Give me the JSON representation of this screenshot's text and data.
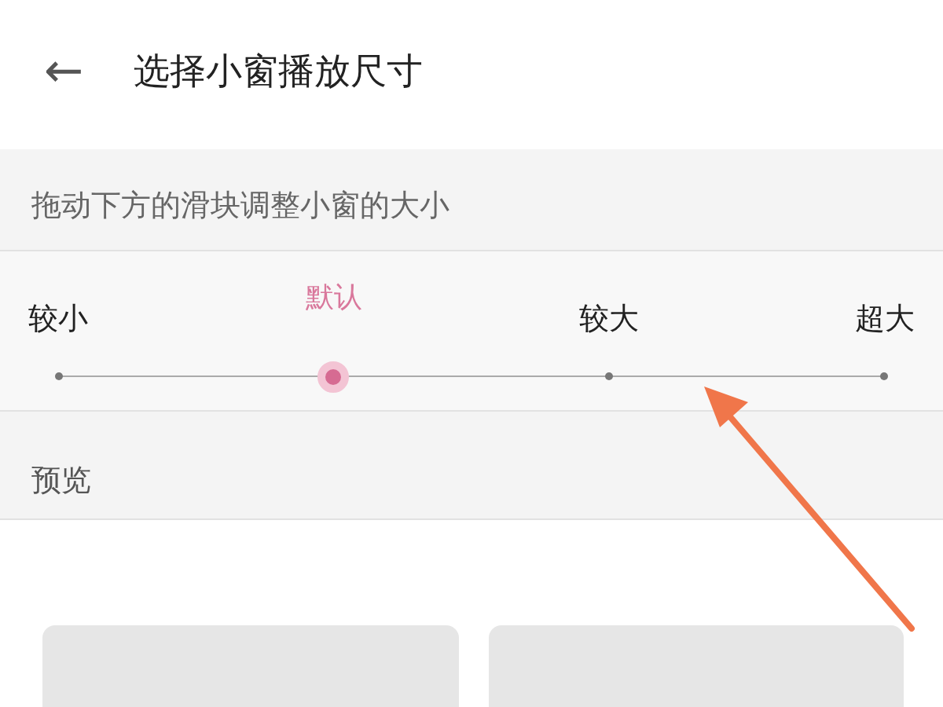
{
  "header": {
    "back": "←",
    "title": "选择小窗播放尺寸"
  },
  "hint": "拖动下方的滑块调整小窗的大小",
  "sizes": [
    {
      "label": "较小",
      "selected": false
    },
    {
      "label": "默认",
      "selected": true
    },
    {
      "label": "较大",
      "selected": false
    },
    {
      "label": "超大",
      "selected": false
    }
  ],
  "preview": {
    "title": "预览"
  }
}
